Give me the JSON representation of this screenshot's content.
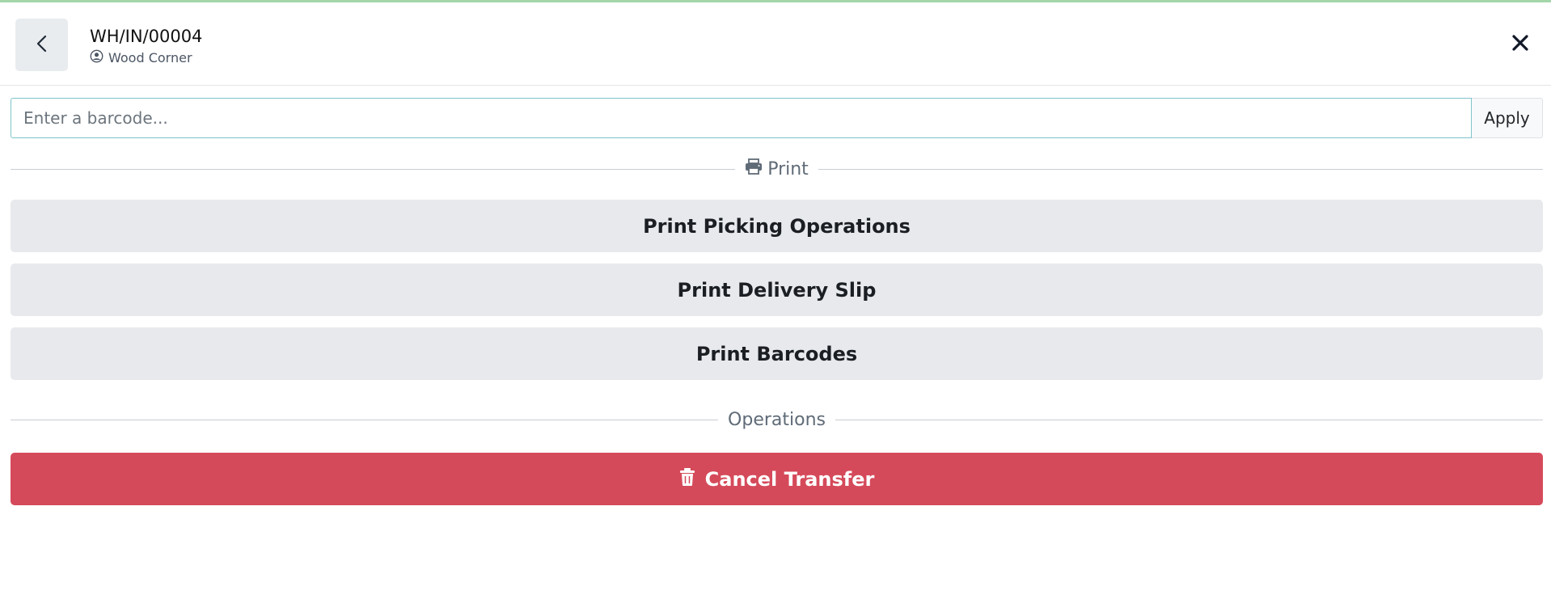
{
  "header": {
    "title": "WH/IN/00004",
    "partner": "Wood Corner",
    "back_icon": "chevron-left-icon",
    "close_icon": "close-icon"
  },
  "barcode": {
    "placeholder": "Enter a barcode...",
    "value": "",
    "apply_label": "Apply"
  },
  "print_section": {
    "label": "Print",
    "icon": "printer-icon",
    "buttons": [
      {
        "label": "Print Picking Operations"
      },
      {
        "label": "Print Delivery Slip"
      },
      {
        "label": "Print Barcodes"
      }
    ]
  },
  "operations_section": {
    "label": "Operations",
    "cancel_label": "Cancel Transfer",
    "cancel_icon": "trash-icon",
    "cancel_color": "#d54a5a"
  }
}
